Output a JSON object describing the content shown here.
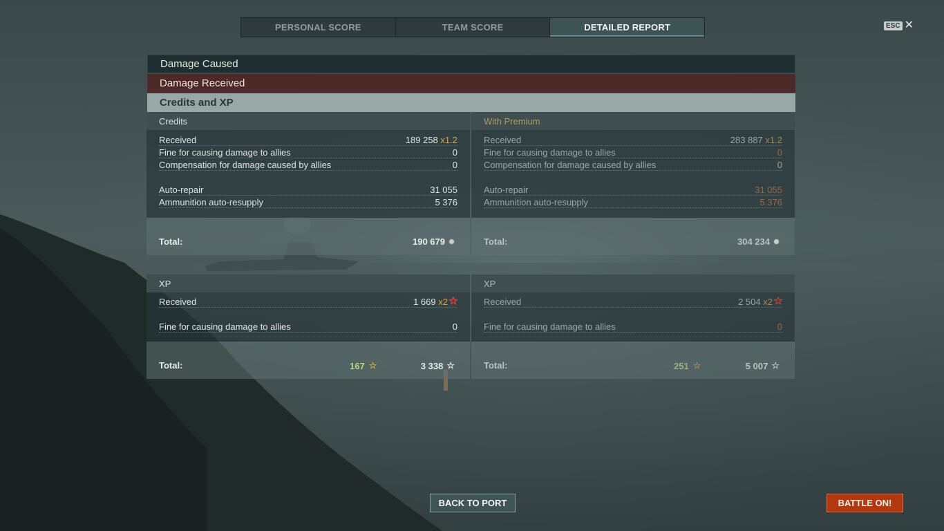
{
  "tabs": [
    {
      "label": "PERSONAL SCORE"
    },
    {
      "label": "TEAM SCORE"
    },
    {
      "label": "DETAILED REPORT"
    }
  ],
  "esc": {
    "key": "ESC",
    "close": "✕"
  },
  "sections": {
    "damage_caused": "Damage Caused",
    "damage_received": "Damage Received",
    "credits_xp": "Credits and XP"
  },
  "credits": {
    "header": "Credits",
    "received_label": "Received",
    "received_value": "189 258",
    "received_mult": "x1.2",
    "fine_label": "Fine for causing damage to allies",
    "fine_value": "0",
    "comp_label": "Compensation for damage caused by allies",
    "comp_value": "0",
    "repair_label": "Auto-repair",
    "repair_value": "31 055",
    "ammo_label": "Ammunition auto-resupply",
    "ammo_value": "5 376",
    "total_label": "Total:",
    "total_value": "190 679"
  },
  "credits_premium": {
    "header": "With Premium",
    "received_label": "Received",
    "received_value": "283 887",
    "received_mult": "x1.2",
    "fine_label": "Fine for causing damage to allies",
    "fine_value": "0",
    "comp_label": "Compensation for damage caused by allies",
    "comp_value": "0",
    "repair_label": "Auto-repair",
    "repair_value": "31 055",
    "ammo_label": "Ammunition auto-resupply",
    "ammo_value": "5 376",
    "total_label": "Total:",
    "total_value": "304 234"
  },
  "xp": {
    "header": "XP",
    "received_label": "Received",
    "received_value": "1 669",
    "received_mult": "x2",
    "fine_label": "Fine for causing damage to allies",
    "fine_value": "0",
    "total_label": "Total:",
    "total_free": "167",
    "total_value": "3 338"
  },
  "xp_premium": {
    "header": "XP",
    "received_label": "Received",
    "received_value": "2 504",
    "received_mult": "x2",
    "fine_label": "Fine for causing damage to allies",
    "fine_value": "0",
    "total_label": "Total:",
    "total_free": "251",
    "total_value": "5 007"
  },
  "icons": {
    "star": "☆"
  },
  "buttons": {
    "back": "BACK TO PORT",
    "battle": "BATTLE ON!"
  },
  "colors": {
    "accent_orange": "#d9792a",
    "battle_button": "#b3380f",
    "damage_received_bar": "#4d2a28"
  }
}
